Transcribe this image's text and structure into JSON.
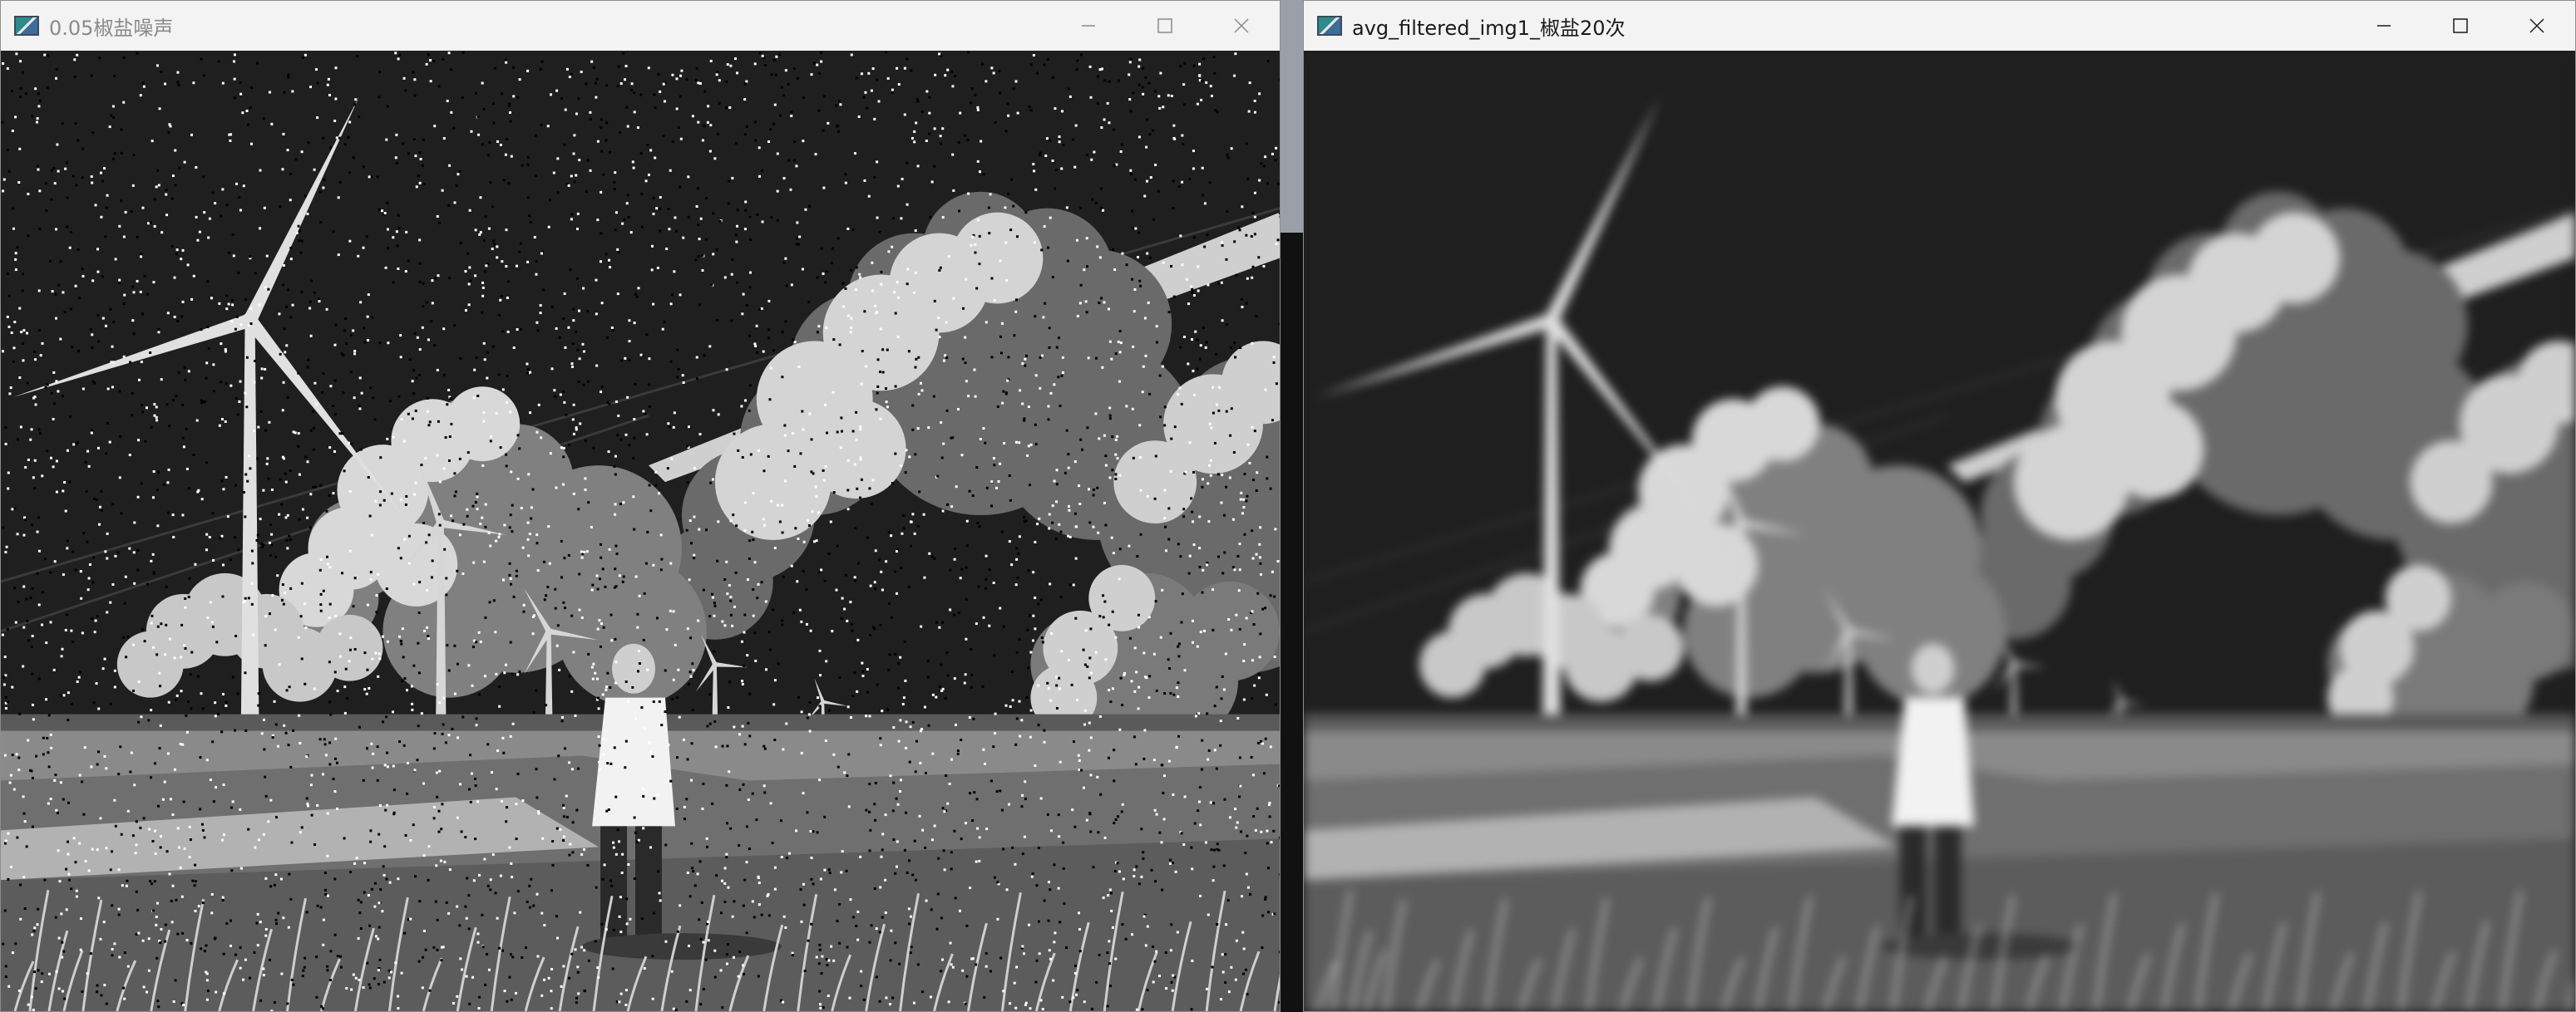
{
  "windows": [
    {
      "id": "left",
      "title": "0.05椒盐噪声",
      "active": false
    },
    {
      "id": "right",
      "title": "avg_filtered_img1_椒盐20次",
      "active": true
    }
  ],
  "controls": {
    "minimize_icon": "minimize-icon",
    "maximize_icon": "maximize-icon",
    "close_icon": "close-icon"
  },
  "image": {
    "scene": "grayscale anime landscape with wind turbines, clouds and a standing figure",
    "left_noise": "salt-and-pepper",
    "right_processing": "average filter"
  }
}
